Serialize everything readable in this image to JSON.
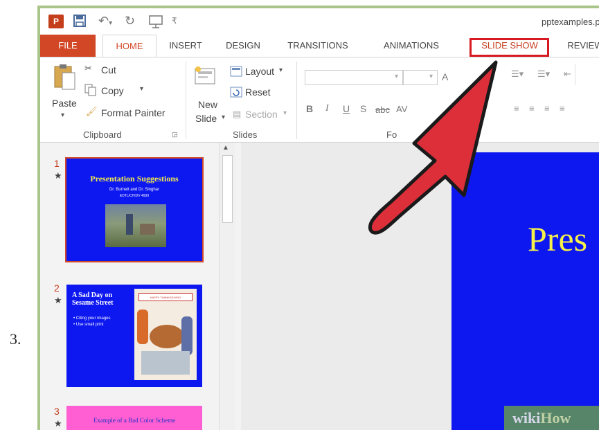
{
  "step_label": "3.",
  "title_bar": {
    "filename": "pptexamples.p"
  },
  "tabs": {
    "file": "FILE",
    "home": "HOME",
    "insert": "INSERT",
    "design": "DESIGN",
    "transitions": "TRANSITIONS",
    "animations": "ANIMATIONS",
    "slide_show": "SLIDE SHOW",
    "review": "REVIEW"
  },
  "ribbon": {
    "clipboard": {
      "paste": "Paste",
      "cut": "Cut",
      "copy": "Copy",
      "format_painter": "Format Painter",
      "group_label": "Clipboard"
    },
    "slides": {
      "new_slide_1": "New",
      "new_slide_2": "Slide",
      "layout": "Layout",
      "reset": "Reset",
      "section": "Section",
      "group_label": "Slides"
    },
    "font": {
      "bold": "B",
      "italic": "I",
      "underline": "U",
      "strike": "S",
      "abc": "abc",
      "spacing": "AV",
      "grow": "A",
      "group_label": "Fo"
    }
  },
  "thumbnails": [
    {
      "number": "1",
      "title": "Presentation Suggestions",
      "subtitle": "Dr. Burnett and Dr. Singhar",
      "subtitle2": "EDTL/CHIDV 4930"
    },
    {
      "number": "2",
      "title": "A Sad Day on Sesame Street",
      "bullets": [
        "Citing your images",
        "Use small print"
      ],
      "banner": "HAPPY THANKSGIVING"
    },
    {
      "number": "3",
      "title": "Example of a Bad Color Scheme"
    }
  ],
  "main_slide": {
    "title": "Pres"
  },
  "watermark": {
    "wiki": "wiki",
    "how": "How"
  },
  "colors": {
    "accent": "#d24726",
    "highlight": "#d71921",
    "slide_blue": "#0d17f0",
    "arrow": "#dc2f3a",
    "frame": "#a9c58a"
  }
}
